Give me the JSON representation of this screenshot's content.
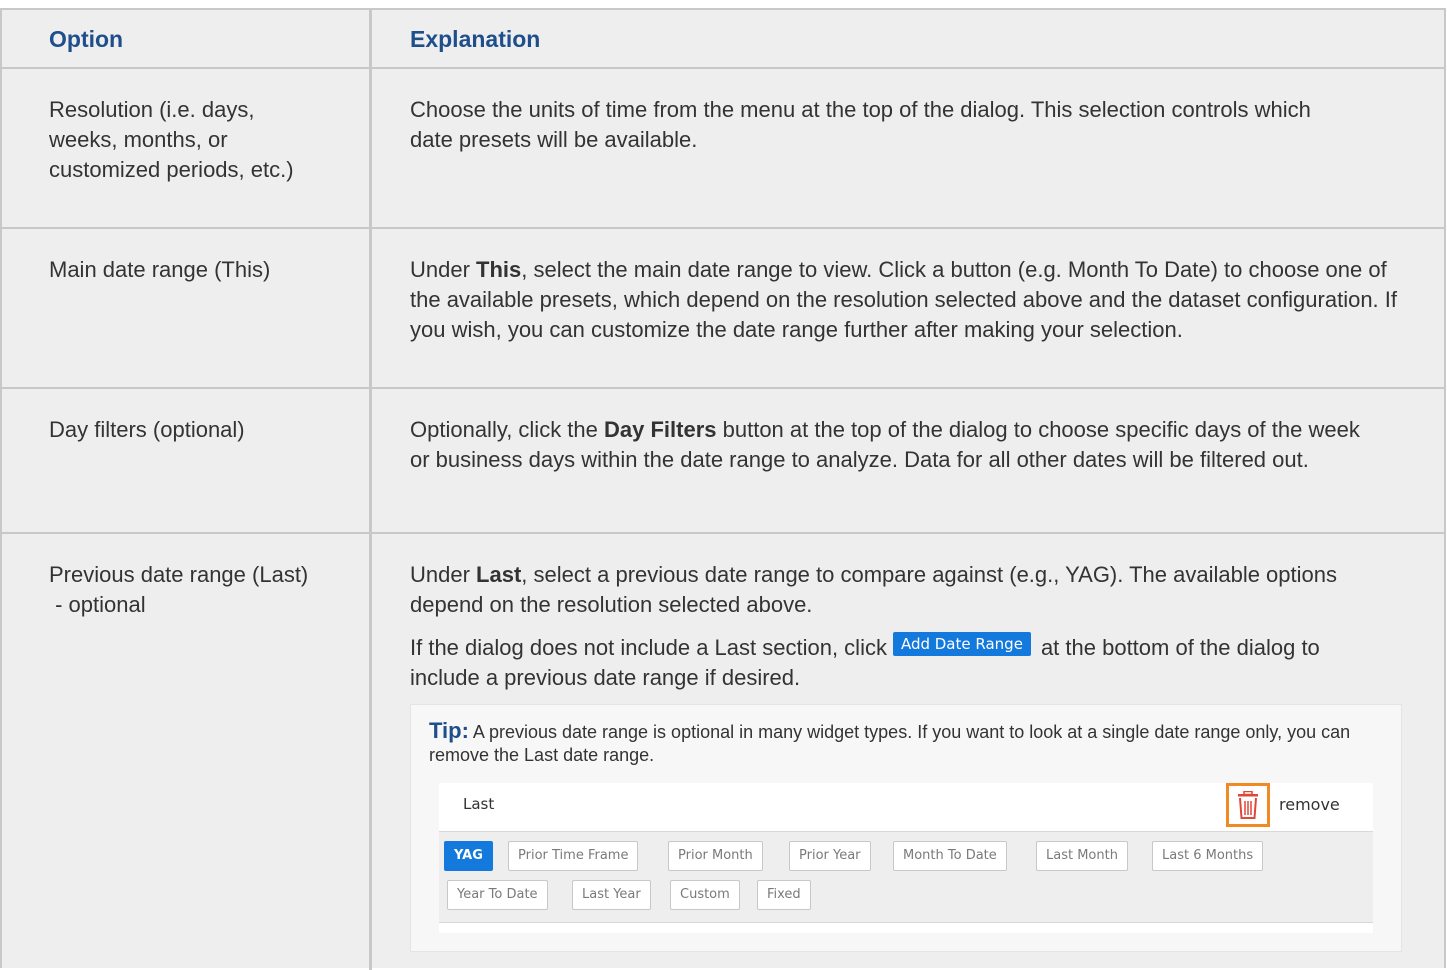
{
  "header": {
    "option": "Option",
    "explanation": "Explanation"
  },
  "rows": [
    {
      "option": "Resolution (i.e. days, weeks, months, or customized periods, etc.)",
      "explanation": "Choose the units of time from the menu at the top of the dialog. This selection controls which date presets will be available."
    },
    {
      "option": "Main date range (This)",
      "exp_pre": "Under ",
      "exp_bold": "This",
      "exp_post": ", select the main date range to view. Click a button (e.g. Month To Date) to choose one of the available presets, which depend on the resolution selected above and the dataset configuration. If you wish, you can customize the date range further after making your selection."
    },
    {
      "option": "Day filters (optional)",
      "exp_pre": "Optionally, click the ",
      "exp_bold": "Day Filters",
      "exp_post": " button at the top of the dialog to choose specific days of the week or business days within the date range to analyze. Data for all other dates will be filtered out."
    },
    {
      "option_line1": "Previous date range (Last)",
      "option_line2": " - optional",
      "exp_pre": "Under ",
      "exp_bold": "Last",
      "exp_post": ", select a previous date range to compare against (e.g., YAG). The available options depend on the resolution selected above.",
      "p2_pre": "If the dialog does not include a Last section, click",
      "p2_button": "Add Date Range",
      "p2_post": "at the bottom of the dialog to include a previous date range if desired."
    }
  ],
  "tip": {
    "label": "Tip:",
    "text": " A previous date range is optional in many widget types. If you want to look at a single date range only, you can remove the Last date range.",
    "screenshot": {
      "section_label": "Last",
      "remove_label": "remove",
      "trash_icon": "trash-icon",
      "trash_color": "#e0463a",
      "highlight_color": "#f08a24",
      "buttons_row1": [
        "YAG",
        "Prior Time Frame",
        "Prior Month",
        "Prior Year",
        "Month To Date",
        "Last Month",
        "Last 6 Months"
      ],
      "buttons_row2": [
        "Year To Date",
        "Last Year",
        "Custom",
        "Fixed"
      ],
      "active_button": "YAG"
    }
  },
  "colors": {
    "heading": "#1f4e8c",
    "accent": "#1479dc",
    "border": "#c8c8c8",
    "cell_bg": "#eeeeee"
  }
}
